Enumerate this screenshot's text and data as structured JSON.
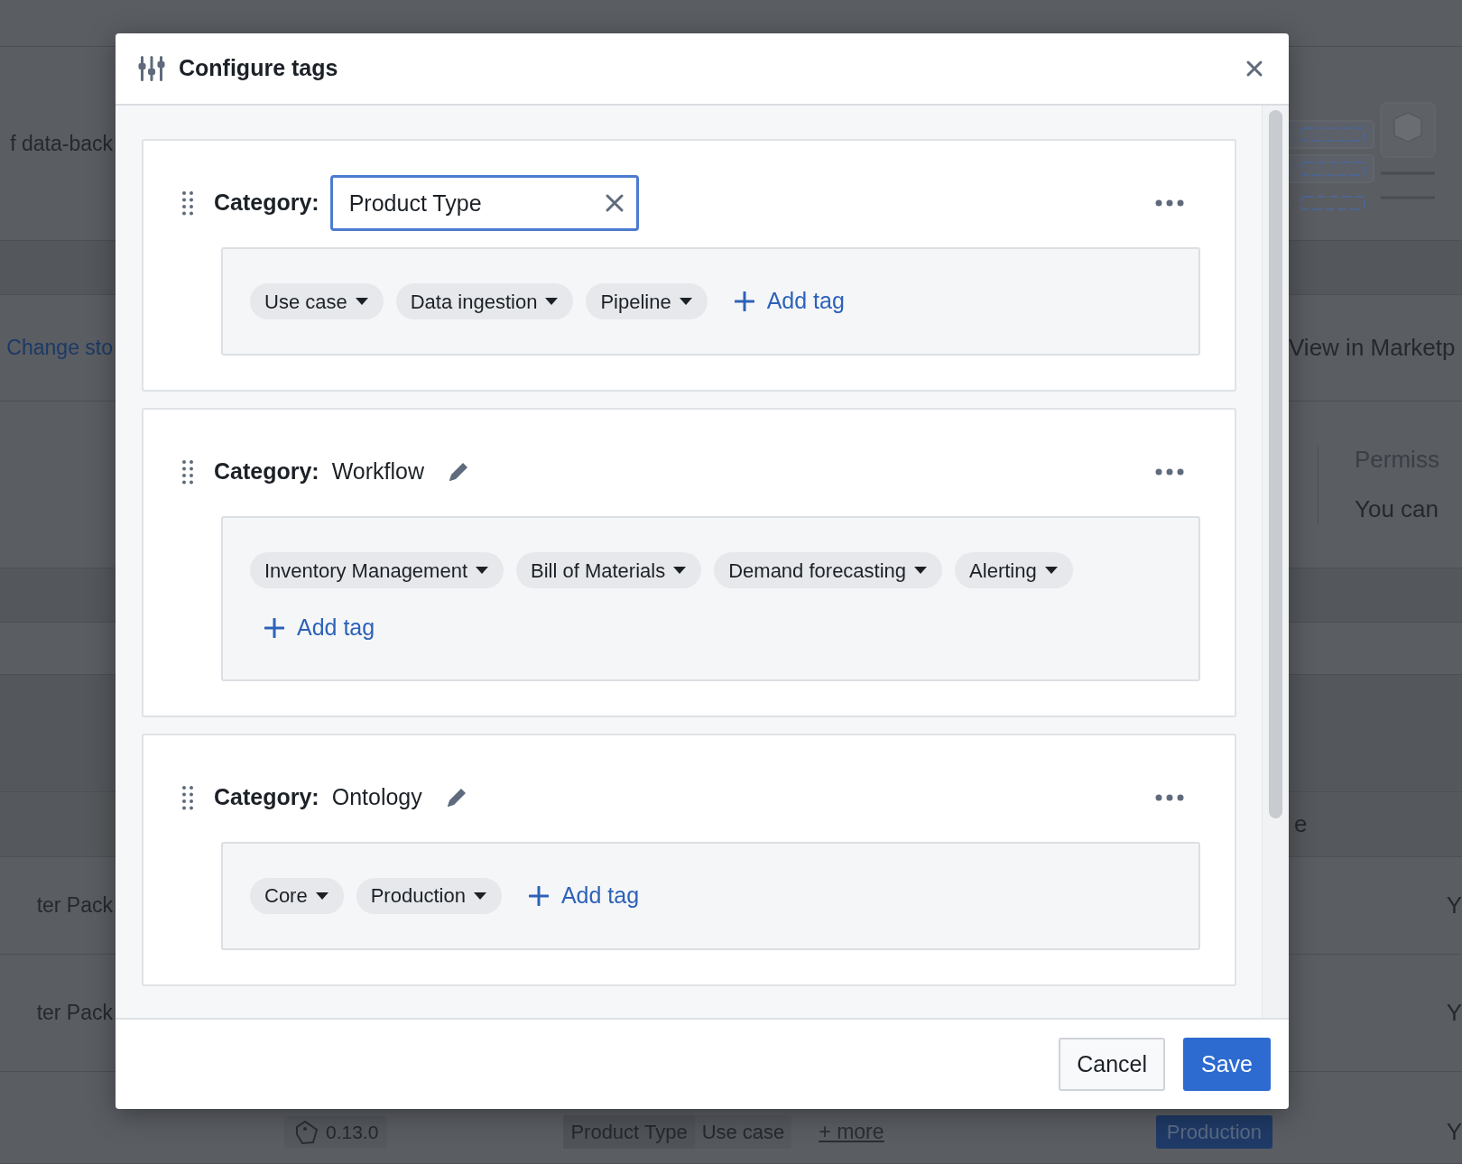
{
  "page": {
    "rows": [
      {
        "kind": "plain"
      },
      {
        "kind": "plain",
        "left": "f data-back",
        "illustration": true
      },
      {
        "kind": "band"
      },
      {
        "kind": "plain",
        "left": "Change sto",
        "left_link": true,
        "right": "View in Marketp"
      },
      {
        "kind": "plain",
        "right_title": "Permiss",
        "right": "You can"
      },
      {
        "kind": "band"
      },
      {
        "kind": "plain"
      },
      {
        "kind": "band"
      },
      {
        "kind": "header",
        "right": "e"
      },
      {
        "kind": "plain",
        "left": "ter Pack",
        "right_edge": "Y"
      },
      {
        "kind": "plain",
        "left": "ter Pack",
        "right_edge": "Y"
      },
      {
        "kind": "plain",
        "version": "0.13.0",
        "tags": [
          "Product Type",
          "Use case"
        ],
        "more": "+ more",
        "status": "Production",
        "right_edge": "Y"
      }
    ]
  },
  "dialog": {
    "title": "Configure tags",
    "categories": [
      {
        "label": "Category:",
        "name": "Product Type",
        "editing": true,
        "tags": [
          "Use case",
          "Data ingestion",
          "Pipeline"
        ],
        "add_label": "Add tag"
      },
      {
        "label": "Category:",
        "name": "Workflow",
        "editing": false,
        "tags": [
          "Inventory Management",
          "Bill of Materials",
          "Demand forecasting",
          "Alerting"
        ],
        "add_label": "Add tag"
      },
      {
        "label": "Category:",
        "name": "Ontology",
        "editing": false,
        "tags": [
          "Core",
          "Production"
        ],
        "add_label": "Add tag"
      }
    ],
    "buttons": [
      {
        "label": "Cancel",
        "kind": "secondary"
      },
      {
        "label": "Save",
        "kind": "primary"
      }
    ]
  }
}
